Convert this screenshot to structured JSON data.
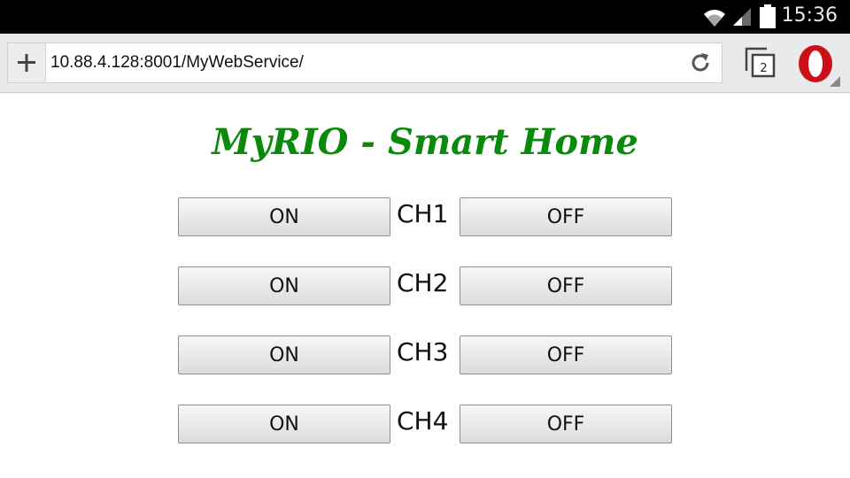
{
  "status_bar": {
    "time": "15:36"
  },
  "browser": {
    "url": "10.88.4.128:8001/MyWebService/",
    "tab_count": "2"
  },
  "page": {
    "title": "MyRIO - Smart Home",
    "channels": [
      {
        "label": "CH1",
        "on_label": "ON",
        "off_label": "OFF"
      },
      {
        "label": "CH2",
        "on_label": "ON",
        "off_label": "OFF"
      },
      {
        "label": "CH3",
        "on_label": "ON",
        "off_label": "OFF"
      },
      {
        "label": "CH4",
        "on_label": "ON",
        "off_label": "OFF"
      }
    ]
  },
  "colors": {
    "title": "#0a8a0a",
    "status_bar": "#000000",
    "toolbar": "#e9eaeb",
    "opera_red": "#cc0f16"
  }
}
